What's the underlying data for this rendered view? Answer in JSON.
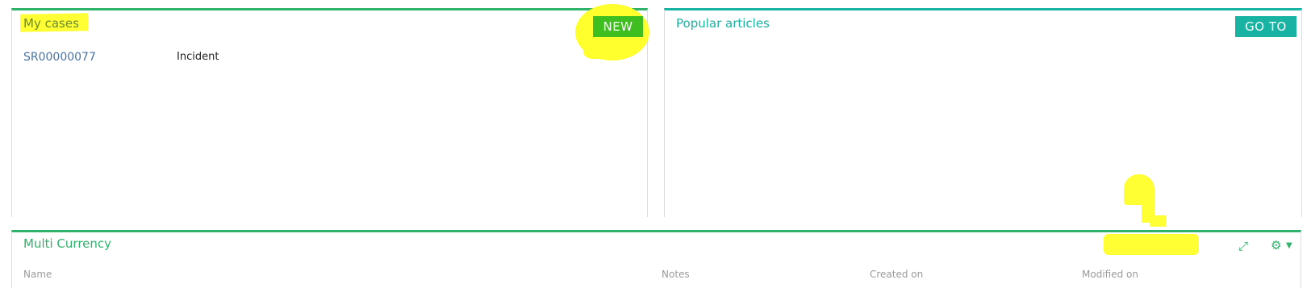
{
  "cases_panel": {
    "title": "My cases",
    "new_label": "NEW",
    "cases": [
      {
        "number": "SR00000077",
        "type": "Incident"
      }
    ]
  },
  "articles_panel": {
    "title": "Popular articles",
    "goto_label": "GO TO"
  },
  "currency_panel": {
    "title": "Multi Currency",
    "icons": {
      "expand": "expand-icon",
      "settings": "gear-icon",
      "menu": "caret-down-icon"
    },
    "columns": [
      "Name",
      "Notes",
      "Created on",
      "Modified on"
    ]
  },
  "colors": {
    "green_accent": "#2fb36b",
    "teal_accent": "#19b3a3",
    "new_button": "#3fbf1f",
    "highlight": "#ffff33",
    "link": "#4a73a8"
  }
}
